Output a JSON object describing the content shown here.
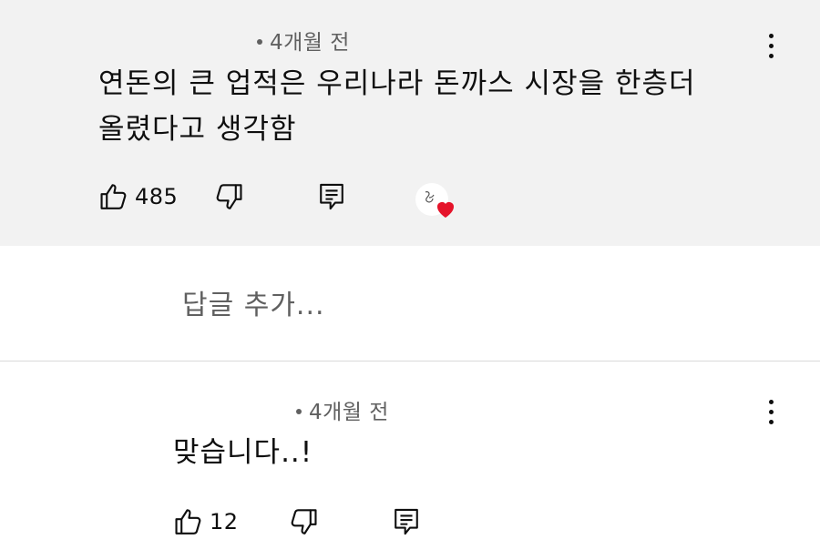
{
  "comments": [
    {
      "time": "4개월 전",
      "text_line1": "연돈의 큰 업적은 우리나라 돈까스 시장을 한층더",
      "text_line2": "올렸다고 생각함",
      "likes": "485"
    },
    {
      "time": "4개월 전",
      "text": "맞습니다..!",
      "likes": "12"
    }
  ],
  "reply_box": {
    "placeholder": "답글 추가..."
  },
  "colors": {
    "highlight_bg": "#f2f2f2",
    "text": "#0f0f0f",
    "secondary_text": "#606060",
    "heart": "#e5132a"
  },
  "icons": [
    "thumb-up-icon",
    "thumb-down-icon",
    "reply-icon",
    "creator-heart-icon",
    "more-vert-icon"
  ]
}
